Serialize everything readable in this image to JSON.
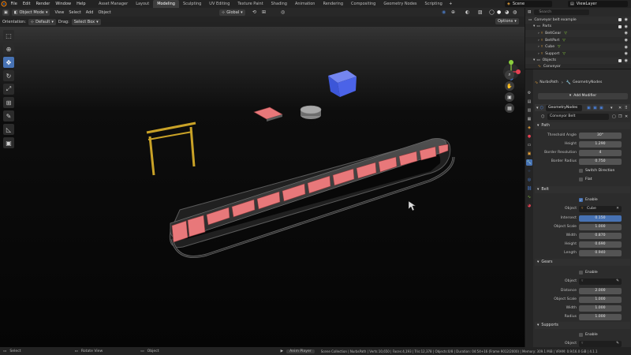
{
  "menu": {
    "items": [
      "File",
      "Edit",
      "Render",
      "Window",
      "Help"
    ]
  },
  "workspaces": [
    {
      "label": "Asset Manager",
      "active": false
    },
    {
      "label": "Layout",
      "active": false
    },
    {
      "label": "Modeling",
      "active": true
    },
    {
      "label": "Sculpting",
      "active": false
    },
    {
      "label": "UV Editing",
      "active": false
    },
    {
      "label": "Texture Paint",
      "active": false
    },
    {
      "label": "Shading",
      "active": false
    },
    {
      "label": "Animation",
      "active": false
    },
    {
      "label": "Rendering",
      "active": false
    },
    {
      "label": "Compositing",
      "active": false
    },
    {
      "label": "Geometry Nodes",
      "active": false
    },
    {
      "label": "Scripting",
      "active": false
    }
  ],
  "scene": {
    "name": "Scene",
    "view_layer": "ViewLayer"
  },
  "viewport_header": {
    "mode": "Object Mode",
    "menus": [
      "View",
      "Select",
      "Add",
      "Object"
    ],
    "transform_orientation": "Global"
  },
  "tool_settings": {
    "orientation_label": "Orientation:",
    "orientation_value": "Default",
    "drag_label": "Drag:",
    "drag_value": "Select Box",
    "options_label": "Options"
  },
  "outliner": {
    "rows": [
      {
        "label": "Conveyor belt example",
        "indent": 0
      },
      {
        "label": "Parts",
        "indent": 1
      },
      {
        "label": "BeltGear",
        "indent": 2
      },
      {
        "label": "BeltPart",
        "indent": 2
      },
      {
        "label": "Cube",
        "indent": 2
      },
      {
        "label": "Support",
        "indent": 2
      },
      {
        "label": "Objects",
        "indent": 1
      },
      {
        "label": "Conveyor",
        "indent": 2
      }
    ],
    "search_placeholder": "Search"
  },
  "properties": {
    "breadcrumb_object": "NurbsPath",
    "breadcrumb_modifier": "GeometryNodes",
    "add_modifier_label": "Add Modifier",
    "modifier_name": "GeometryNodes",
    "node_group": "Conveyor Belt",
    "sections": {
      "path": "Path",
      "belt": "Belt",
      "gears": "Gears",
      "supports": "Supports"
    },
    "path_fields": [
      {
        "label": "Threshold Angle",
        "value": "30°"
      },
      {
        "label": "Height",
        "value": "1.290"
      },
      {
        "label": "Border Resolution",
        "value": "4"
      },
      {
        "label": "Border Radius",
        "value": "0.750"
      }
    ],
    "switch_direction_label": "Switch Direction",
    "flat_label": "Flat",
    "belt_enable_label": "Enable",
    "belt_object_label": "Object",
    "belt_object_value": "Cube",
    "belt_fields": [
      {
        "label": "Intersect",
        "value": "0.150"
      },
      {
        "label": "Object Scale",
        "value": "1.000"
      },
      {
        "label": "Width",
        "value": "0.870"
      },
      {
        "label": "Height",
        "value": "0.690"
      },
      {
        "label": "Length",
        "value": "0.940"
      }
    ],
    "gears_enable_label": "Enable",
    "gears_object_label": "Object",
    "gears_fields": [
      {
        "label": "Distance",
        "value": "2.000"
      },
      {
        "label": "Object Scale",
        "value": "1.000"
      },
      {
        "label": "Width",
        "value": "1.000"
      },
      {
        "label": "Radius",
        "value": "1.000"
      }
    ],
    "supports_enable_label": "Enable",
    "supports_object_label": "Object"
  },
  "statusbar": {
    "select": "Select",
    "rotate": "Rotate View",
    "object": "Object",
    "anim_player": "Anim Player",
    "stats": "Scene Collection | NurbsPath | Verts:10,650 | Faces:4,193 | Tris:12,378 | Objects:0/8 | Duration: 04:54+16 (Frame 9012/2000) | Memory: 309.1 MiB | VRAM: 0.9/16.0 GiB | 4.1.1"
  },
  "colors": {
    "accent": "#4772b3",
    "belt_pad": "#e8787a",
    "cube": "#4b63e8",
    "support": "#c9a227"
  }
}
